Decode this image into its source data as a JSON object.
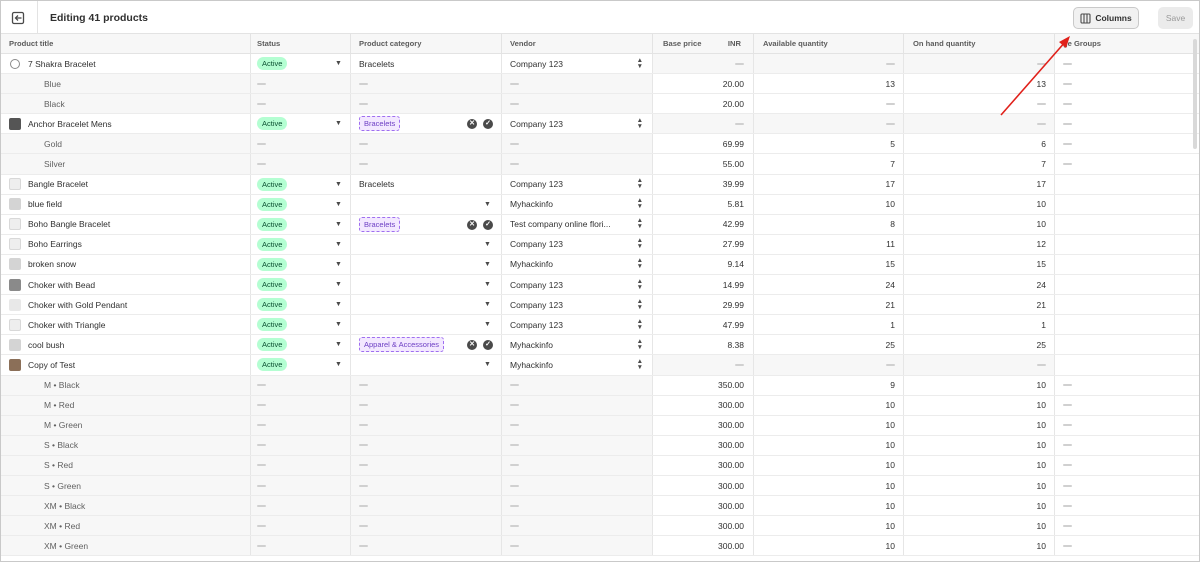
{
  "header": {
    "title": "Editing 41 products",
    "columns_label": "Columns",
    "save_label": "Save"
  },
  "columns": {
    "title": "Product title",
    "status": "Status",
    "category": "Product category",
    "vendor": "Vendor",
    "price": "Base price",
    "currency": "INR",
    "available": "Available quantity",
    "on_hand": "On hand quantity",
    "age": "ge Groups"
  },
  "rows": [
    {
      "t": "p",
      "thumb": "circle",
      "title": "7 Shakra Bracelet",
      "status": "Active",
      "cat": "Bracelets",
      "catTag": false,
      "catActions": false,
      "vendor": "Company 123",
      "price": "",
      "avail": "",
      "hand": "",
      "age": true
    },
    {
      "t": "v",
      "title": "Blue",
      "price": "20.00",
      "avail": "13",
      "hand": "13",
      "age": true
    },
    {
      "t": "v",
      "title": "Black",
      "price": "20.00",
      "avail": "",
      "hand": "",
      "age": true
    },
    {
      "t": "p",
      "thumb": "dark",
      "title": "Anchor Bracelet Mens",
      "status": "Active",
      "cat": "Bracelets",
      "catTag": true,
      "catActions": true,
      "vendor": "Company 123",
      "price": "",
      "avail": "",
      "hand": "",
      "age": true
    },
    {
      "t": "v",
      "title": "Gold",
      "price": "69.99",
      "avail": "5",
      "hand": "6",
      "age": true
    },
    {
      "t": "v",
      "title": "Silver",
      "price": "55.00",
      "avail": "7",
      "hand": "7",
      "age": true
    },
    {
      "t": "p",
      "thumb": "plain",
      "title": "Bangle Bracelet",
      "status": "Active",
      "cat": "Bracelets",
      "catTag": false,
      "catActions": false,
      "vendor": "Company 123",
      "price": "39.99",
      "avail": "17",
      "hand": "17",
      "age": false
    },
    {
      "t": "p",
      "thumb": "img",
      "title": "blue field",
      "status": "Active",
      "cat": "",
      "catTag": false,
      "catActions": false,
      "vendor": "Myhackinfo",
      "price": "5.81",
      "avail": "10",
      "hand": "10",
      "age": false
    },
    {
      "t": "p",
      "thumb": "plain",
      "title": "Boho Bangle Bracelet",
      "status": "Active",
      "cat": "Bracelets",
      "catTag": true,
      "catActions": true,
      "vendor": "Test company online flori...",
      "price": "42.99",
      "avail": "8",
      "hand": "10",
      "age": false
    },
    {
      "t": "p",
      "thumb": "plain",
      "title": "Boho Earrings",
      "status": "Active",
      "cat": "",
      "catTag": false,
      "catActions": false,
      "vendor": "Company 123",
      "price": "27.99",
      "avail": "11",
      "hand": "12",
      "age": false
    },
    {
      "t": "p",
      "thumb": "img",
      "title": "broken snow",
      "status": "Active",
      "cat": "",
      "catTag": false,
      "catActions": false,
      "vendor": "Myhackinfo",
      "price": "9.14",
      "avail": "15",
      "hand": "15",
      "age": false
    },
    {
      "t": "p",
      "thumb": "photo",
      "title": "Choker with Bead",
      "status": "Active",
      "cat": "",
      "catTag": false,
      "catActions": false,
      "vendor": "Company 123",
      "price": "14.99",
      "avail": "24",
      "hand": "24",
      "age": false
    },
    {
      "t": "p",
      "thumb": "light",
      "title": "Choker with Gold Pendant",
      "status": "Active",
      "cat": "",
      "catTag": false,
      "catActions": false,
      "vendor": "Company 123",
      "price": "29.99",
      "avail": "21",
      "hand": "21",
      "age": false
    },
    {
      "t": "p",
      "thumb": "plain",
      "title": "Choker with Triangle",
      "status": "Active",
      "cat": "",
      "catTag": false,
      "catActions": false,
      "vendor": "Company 123",
      "price": "47.99",
      "avail": "1",
      "hand": "1",
      "age": false
    },
    {
      "t": "p",
      "thumb": "img",
      "title": "cool bush",
      "status": "Active",
      "cat": "Apparel & Accessories",
      "catTag": true,
      "catActions": true,
      "vendor": "Myhackinfo",
      "price": "8.38",
      "avail": "25",
      "hand": "25",
      "age": false
    },
    {
      "t": "p",
      "thumb": "brown",
      "title": "Copy of Test",
      "status": "Active",
      "cat": "",
      "catTag": false,
      "catActions": false,
      "vendor": "Myhackinfo",
      "price": "",
      "avail": "",
      "hand": "",
      "age": false
    },
    {
      "t": "v",
      "title": "M • Black",
      "price": "350.00",
      "avail": "9",
      "hand": "10",
      "age": true
    },
    {
      "t": "v",
      "title": "M • Red",
      "price": "300.00",
      "avail": "10",
      "hand": "10",
      "age": true
    },
    {
      "t": "v",
      "title": "M • Green",
      "price": "300.00",
      "avail": "10",
      "hand": "10",
      "age": true
    },
    {
      "t": "v",
      "title": "S • Black",
      "price": "300.00",
      "avail": "10",
      "hand": "10",
      "age": true
    },
    {
      "t": "v",
      "title": "S • Red",
      "price": "300.00",
      "avail": "10",
      "hand": "10",
      "age": true
    },
    {
      "t": "v",
      "title": "S • Green",
      "price": "300.00",
      "avail": "10",
      "hand": "10",
      "age": true
    },
    {
      "t": "v",
      "title": "XM • Black",
      "price": "300.00",
      "avail": "10",
      "hand": "10",
      "age": true
    },
    {
      "t": "v",
      "title": "XM • Red",
      "price": "300.00",
      "avail": "10",
      "hand": "10",
      "age": true
    },
    {
      "t": "v",
      "title": "XM • Green",
      "price": "300.00",
      "avail": "10",
      "hand": "10",
      "age": true
    }
  ],
  "colors": {
    "active_badge": "#b4fed2",
    "category_tag": "#f3e8ff",
    "annotation_arrow": "#e0201a"
  },
  "icons": {
    "back": "exit-arrow-icon",
    "columns": "columns-icon",
    "status_dropdown": "chevron-down-icon",
    "vendor_dropdown": "select-updown-icon",
    "remove": "x-circle-icon",
    "confirm": "check-circle-icon"
  }
}
